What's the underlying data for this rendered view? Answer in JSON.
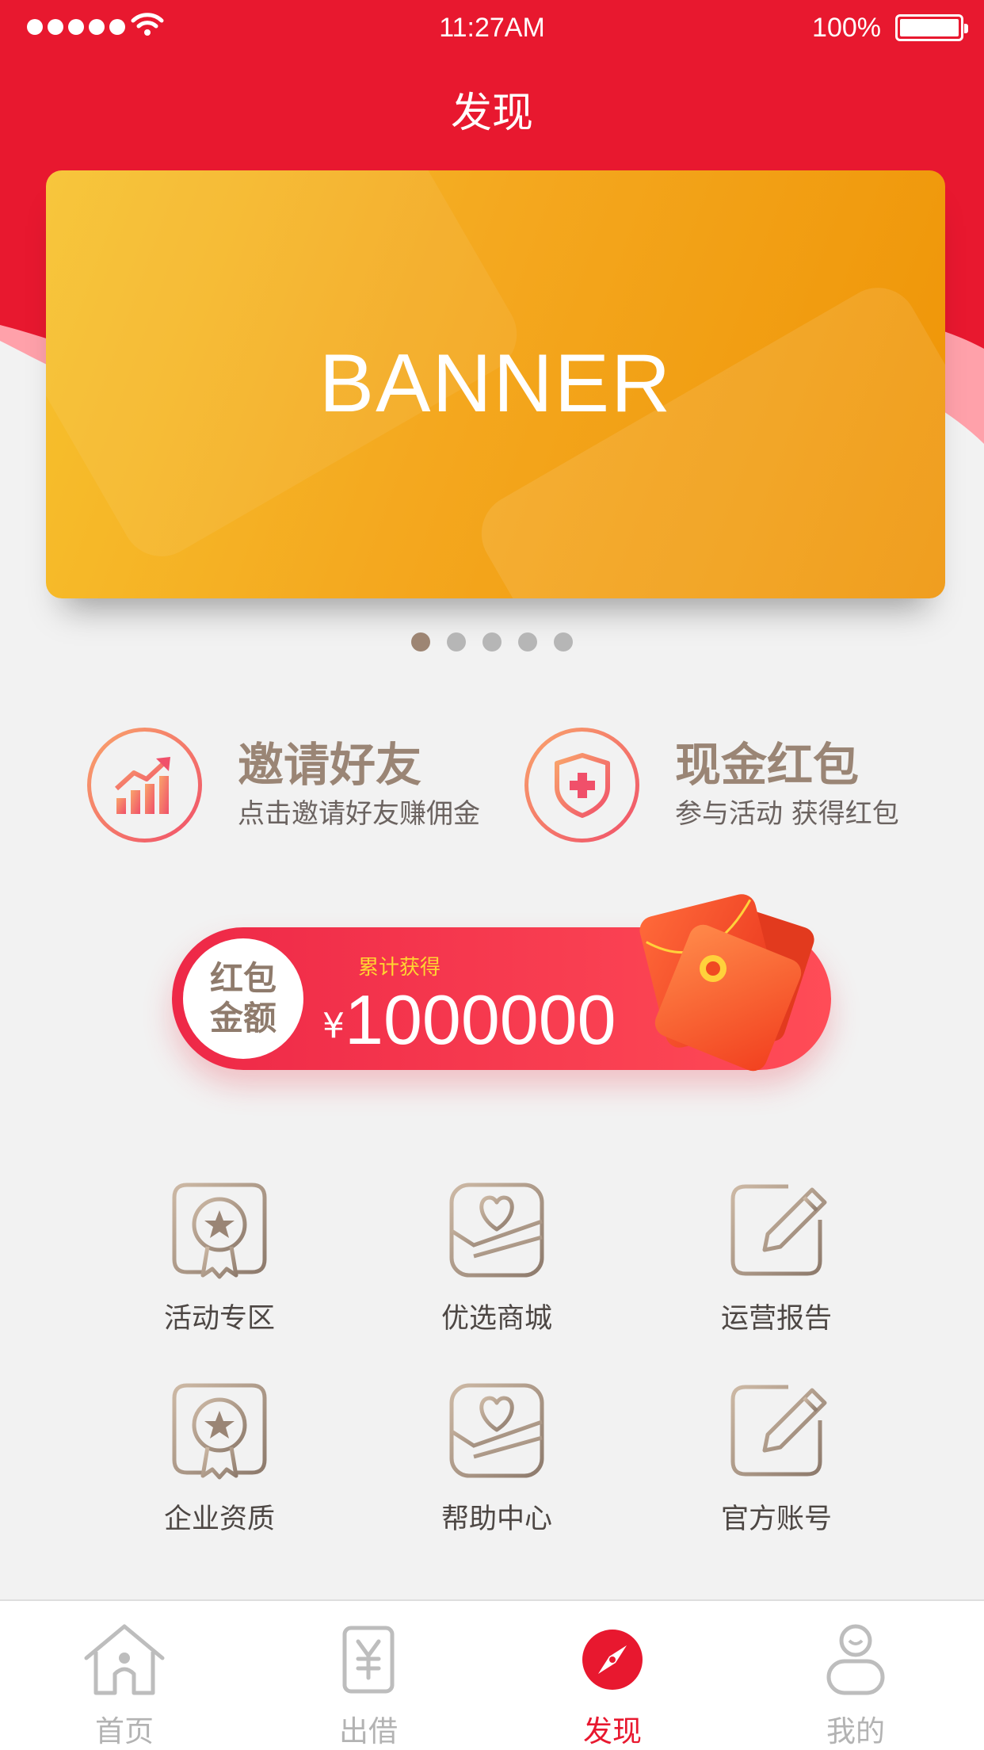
{
  "status_bar": {
    "time": "11:27AM",
    "battery": "100%"
  },
  "header": {
    "title": "发现"
  },
  "banner": {
    "label": "BANNER",
    "page_count": 5,
    "active_index": 0
  },
  "quick_entries": [
    {
      "title": "邀请好友",
      "subtitle": "点击邀请好友赚佣金",
      "icon": "chart-up-icon"
    },
    {
      "title": "现金红包",
      "subtitle": "参与活动 获得红包",
      "icon": "shield-cross-icon"
    }
  ],
  "red_envelope": {
    "badge_line1": "红包",
    "badge_line2": "金额",
    "caption": "累计获得",
    "currency": "¥",
    "amount": "1000000"
  },
  "grid": [
    {
      "label": "活动专区",
      "icon": "medal-icon"
    },
    {
      "label": "优选商城",
      "icon": "heart-envelope-icon"
    },
    {
      "label": "运营报告",
      "icon": "edit-icon"
    },
    {
      "label": "企业资质",
      "icon": "medal-icon"
    },
    {
      "label": "帮助中心",
      "icon": "heart-envelope-icon"
    },
    {
      "label": "官方账号",
      "icon": "edit-icon"
    }
  ],
  "tabbar": [
    {
      "label": "首页",
      "icon": "home-icon"
    },
    {
      "label": "出借",
      "icon": "yuan-doc-icon"
    },
    {
      "label": "发现",
      "icon": "compass-icon",
      "active": true
    },
    {
      "label": "我的",
      "icon": "user-icon"
    }
  ],
  "colors": {
    "brand_red": "#e8182f",
    "banner_orange": "#f4a81f",
    "muted_brown": "#9a8575"
  }
}
